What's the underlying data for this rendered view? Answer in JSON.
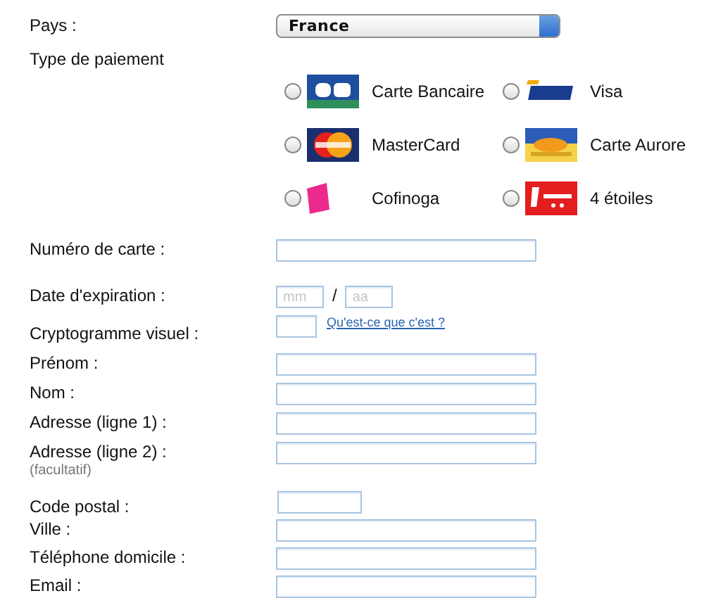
{
  "country": {
    "label": "Pays :",
    "value": "France"
  },
  "payment": {
    "label": "Type de paiement",
    "options": [
      {
        "label": "Carte Bancaire",
        "kind": "cb",
        "selected": false
      },
      {
        "label": "Visa",
        "kind": "visa",
        "selected": false
      },
      {
        "label": "MasterCard",
        "kind": "mastercard",
        "selected": false
      },
      {
        "label": "Carte Aurore",
        "kind": "aurore",
        "selected": false
      },
      {
        "label": "Cofinoga",
        "kind": "cofinoga",
        "selected": false
      },
      {
        "label": "4 étoiles",
        "kind": "etoiles",
        "selected": false
      }
    ]
  },
  "fields": [
    {
      "kind": "text",
      "label": "Numéro de carte :"
    },
    {
      "kind": "date",
      "label": "Date d'expiration :",
      "month_placeholder": "mm",
      "separator": "/",
      "year_placeholder": "aa"
    },
    {
      "kind": "cvv",
      "label": "Cryptogramme visuel :",
      "link": "Qu'est-ce que c'est ?"
    },
    {
      "kind": "text",
      "label": "Prénom :"
    },
    {
      "kind": "text",
      "label": "Nom :"
    },
    {
      "kind": "text",
      "label": "Adresse (ligne 1) :"
    },
    {
      "kind": "text",
      "label": "Adresse (ligne 2) :",
      "note": "(facultatif)"
    },
    {
      "kind": "short",
      "label": "Code postal :"
    },
    {
      "kind": "text",
      "label": "Ville :"
    },
    {
      "kind": "text",
      "label": "Téléphone domicile :"
    },
    {
      "kind": "text",
      "label": "Email :"
    }
  ]
}
